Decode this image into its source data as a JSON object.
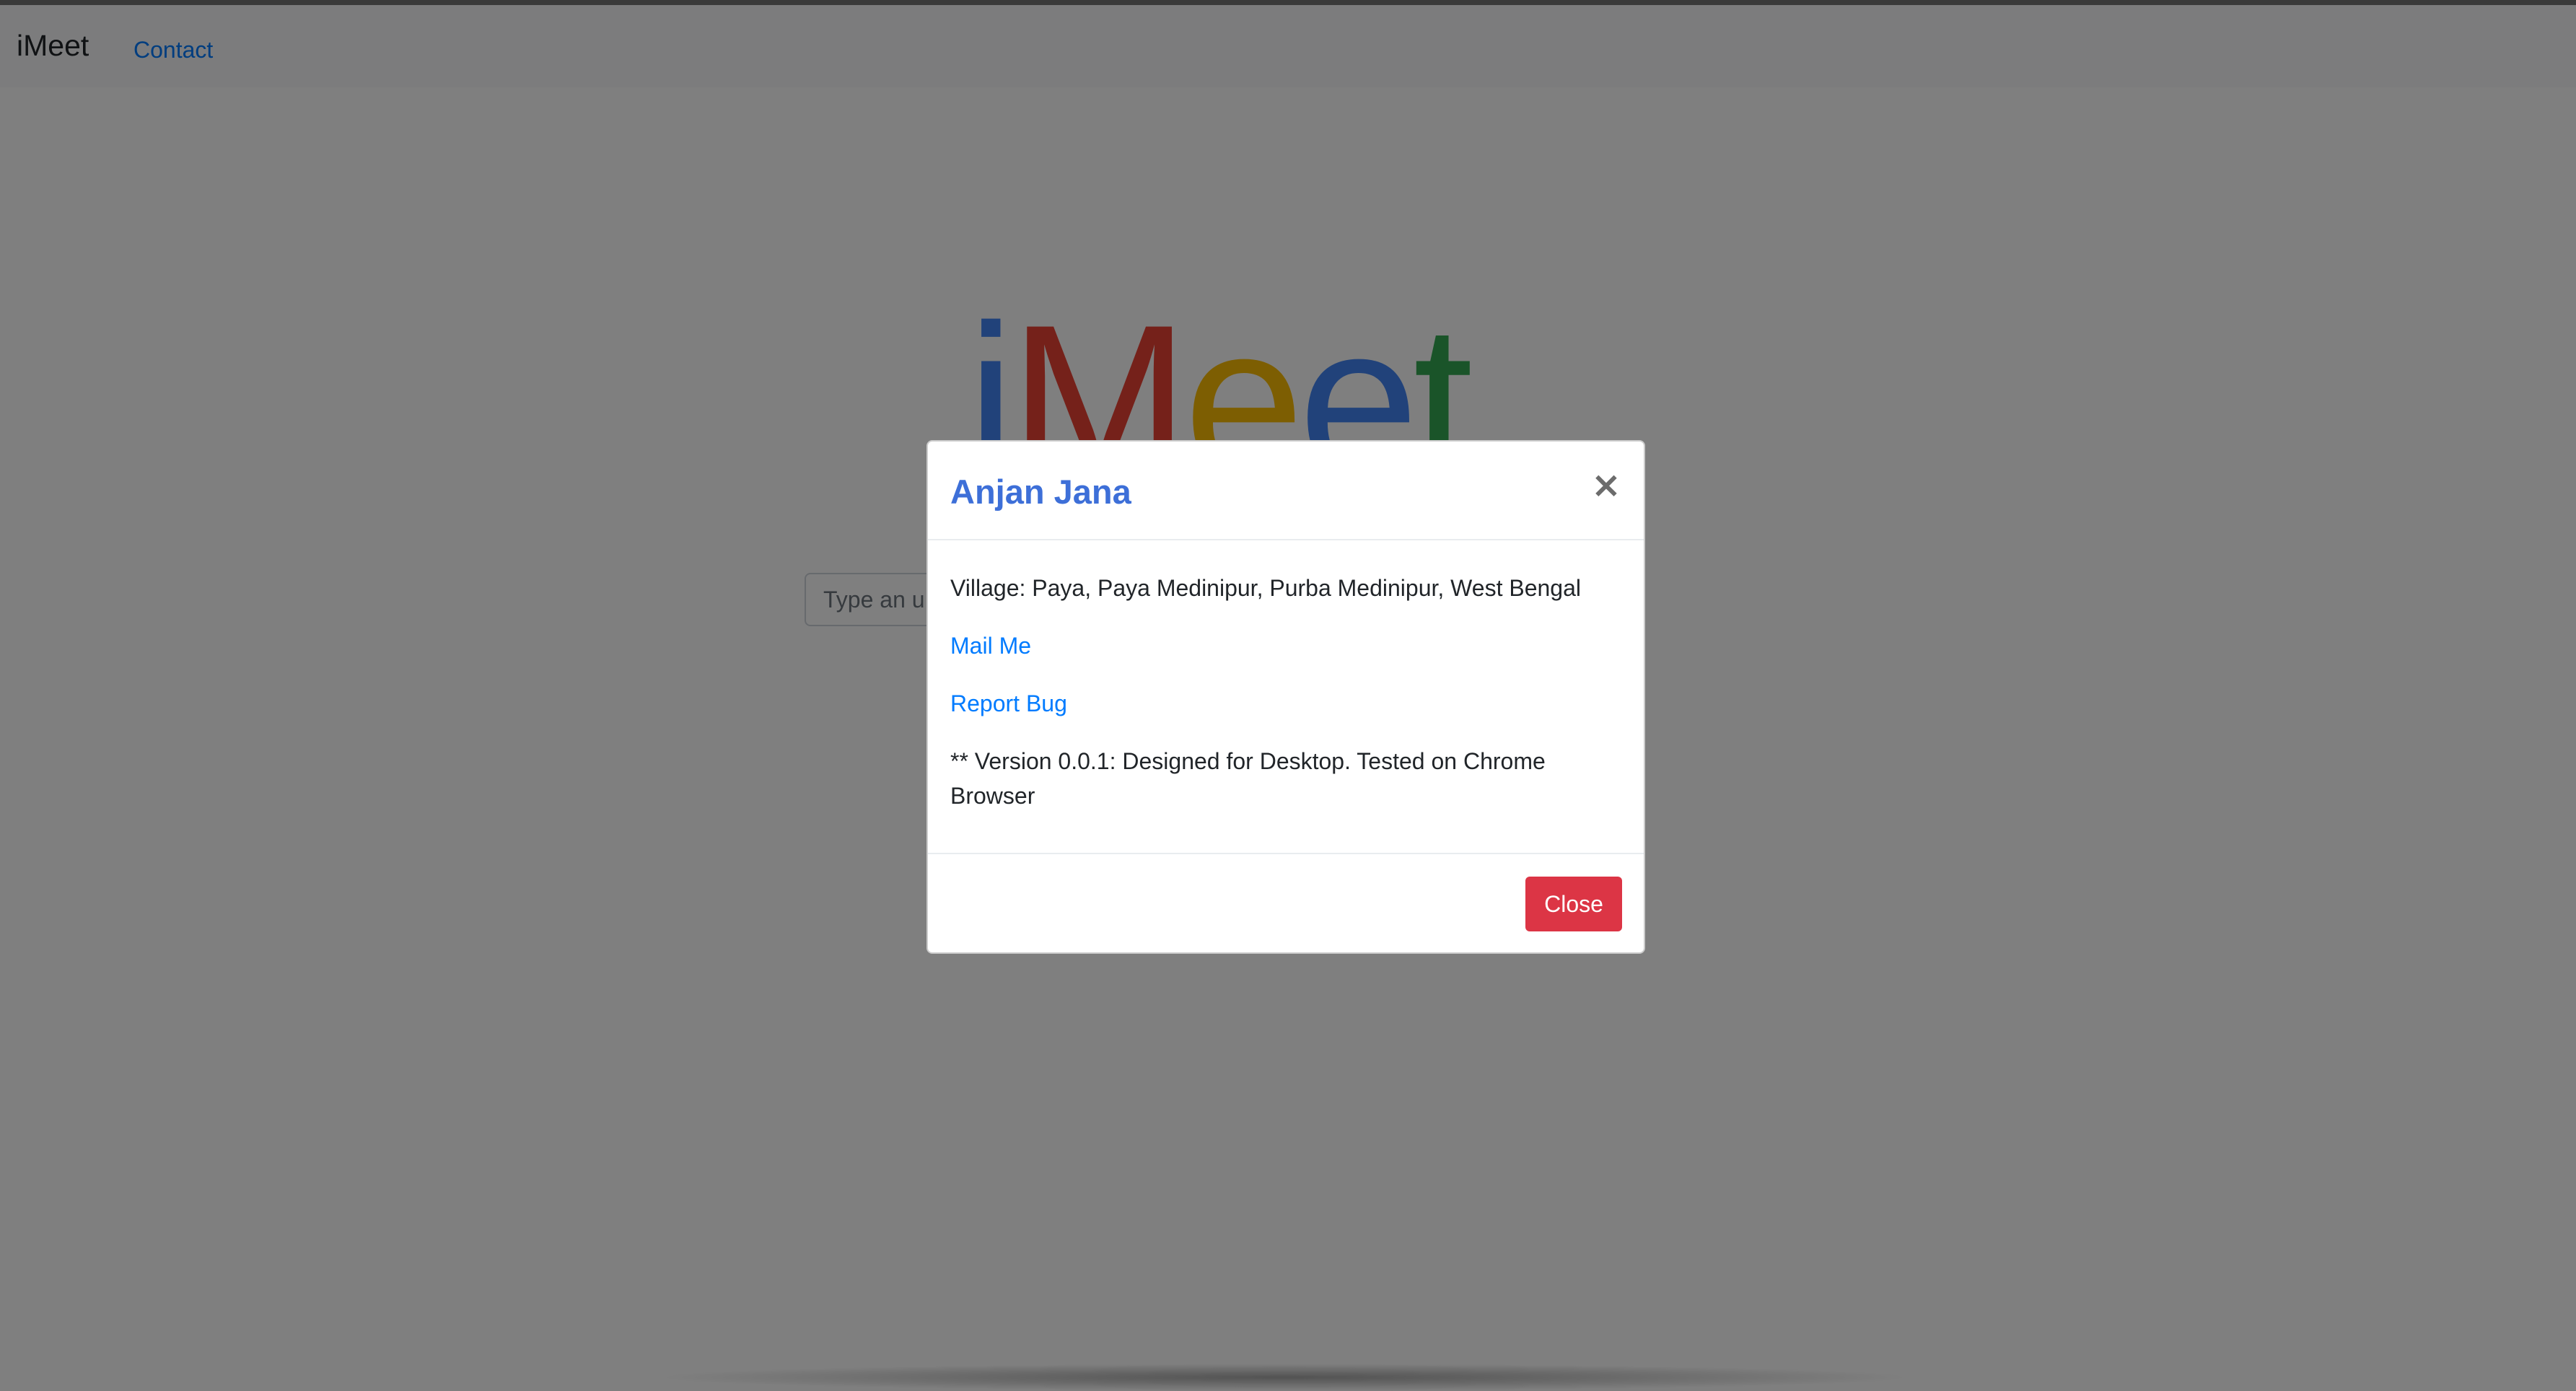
{
  "navbar": {
    "brand": "iMeet",
    "links": [
      "Contact"
    ]
  },
  "logo": {
    "letters": [
      {
        "char": "i",
        "color": "#4285f4"
      },
      {
        "char": "M",
        "color": "#ea4335"
      },
      {
        "char": "e",
        "color": "#fbbc05"
      },
      {
        "char": "e",
        "color": "#4285f4"
      },
      {
        "char": "t",
        "color": "#34a853"
      }
    ]
  },
  "search": {
    "placeholder": "Type an u"
  },
  "modal": {
    "title": "Anjan Jana",
    "close_symbol": "×",
    "address": "Village: Paya, Paya Medinipur, Purba Medinipur, West Bengal",
    "mail_label": "Mail Me",
    "report_label": "Report Bug",
    "version_text": "** Version 0.0.1: Designed for Desktop. Tested on Chrome Browser",
    "close_button": "Close"
  },
  "colors": {
    "link": "#007bff",
    "title": "#3d6fd8",
    "danger": "#dc3545",
    "backdrop": "rgba(0,0,0,0.5)"
  }
}
